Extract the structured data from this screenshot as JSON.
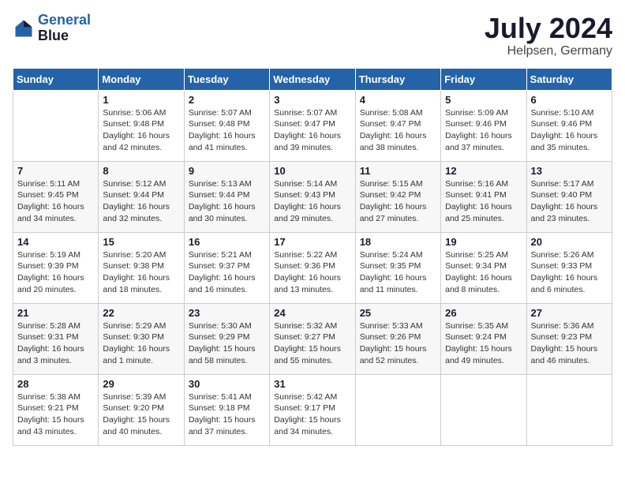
{
  "logo": {
    "line1": "General",
    "line2": "Blue"
  },
  "title": "July 2024",
  "subtitle": "Helpsen, Germany",
  "days_of_week": [
    "Sunday",
    "Monday",
    "Tuesday",
    "Wednesday",
    "Thursday",
    "Friday",
    "Saturday"
  ],
  "weeks": [
    [
      {
        "day": "",
        "info": ""
      },
      {
        "day": "1",
        "info": "Sunrise: 5:06 AM\nSunset: 9:48 PM\nDaylight: 16 hours\nand 42 minutes."
      },
      {
        "day": "2",
        "info": "Sunrise: 5:07 AM\nSunset: 9:48 PM\nDaylight: 16 hours\nand 41 minutes."
      },
      {
        "day": "3",
        "info": "Sunrise: 5:07 AM\nSunset: 9:47 PM\nDaylight: 16 hours\nand 39 minutes."
      },
      {
        "day": "4",
        "info": "Sunrise: 5:08 AM\nSunset: 9:47 PM\nDaylight: 16 hours\nand 38 minutes."
      },
      {
        "day": "5",
        "info": "Sunrise: 5:09 AM\nSunset: 9:46 PM\nDaylight: 16 hours\nand 37 minutes."
      },
      {
        "day": "6",
        "info": "Sunrise: 5:10 AM\nSunset: 9:46 PM\nDaylight: 16 hours\nand 35 minutes."
      }
    ],
    [
      {
        "day": "7",
        "info": "Sunrise: 5:11 AM\nSunset: 9:45 PM\nDaylight: 16 hours\nand 34 minutes."
      },
      {
        "day": "8",
        "info": "Sunrise: 5:12 AM\nSunset: 9:44 PM\nDaylight: 16 hours\nand 32 minutes."
      },
      {
        "day": "9",
        "info": "Sunrise: 5:13 AM\nSunset: 9:44 PM\nDaylight: 16 hours\nand 30 minutes."
      },
      {
        "day": "10",
        "info": "Sunrise: 5:14 AM\nSunset: 9:43 PM\nDaylight: 16 hours\nand 29 minutes."
      },
      {
        "day": "11",
        "info": "Sunrise: 5:15 AM\nSunset: 9:42 PM\nDaylight: 16 hours\nand 27 minutes."
      },
      {
        "day": "12",
        "info": "Sunrise: 5:16 AM\nSunset: 9:41 PM\nDaylight: 16 hours\nand 25 minutes."
      },
      {
        "day": "13",
        "info": "Sunrise: 5:17 AM\nSunset: 9:40 PM\nDaylight: 16 hours\nand 23 minutes."
      }
    ],
    [
      {
        "day": "14",
        "info": "Sunrise: 5:19 AM\nSunset: 9:39 PM\nDaylight: 16 hours\nand 20 minutes."
      },
      {
        "day": "15",
        "info": "Sunrise: 5:20 AM\nSunset: 9:38 PM\nDaylight: 16 hours\nand 18 minutes."
      },
      {
        "day": "16",
        "info": "Sunrise: 5:21 AM\nSunset: 9:37 PM\nDaylight: 16 hours\nand 16 minutes."
      },
      {
        "day": "17",
        "info": "Sunrise: 5:22 AM\nSunset: 9:36 PM\nDaylight: 16 hours\nand 13 minutes."
      },
      {
        "day": "18",
        "info": "Sunrise: 5:24 AM\nSunset: 9:35 PM\nDaylight: 16 hours\nand 11 minutes."
      },
      {
        "day": "19",
        "info": "Sunrise: 5:25 AM\nSunset: 9:34 PM\nDaylight: 16 hours\nand 8 minutes."
      },
      {
        "day": "20",
        "info": "Sunrise: 5:26 AM\nSunset: 9:33 PM\nDaylight: 16 hours\nand 6 minutes."
      }
    ],
    [
      {
        "day": "21",
        "info": "Sunrise: 5:28 AM\nSunset: 9:31 PM\nDaylight: 16 hours\nand 3 minutes."
      },
      {
        "day": "22",
        "info": "Sunrise: 5:29 AM\nSunset: 9:30 PM\nDaylight: 16 hours\nand 1 minute."
      },
      {
        "day": "23",
        "info": "Sunrise: 5:30 AM\nSunset: 9:29 PM\nDaylight: 15 hours\nand 58 minutes."
      },
      {
        "day": "24",
        "info": "Sunrise: 5:32 AM\nSunset: 9:27 PM\nDaylight: 15 hours\nand 55 minutes."
      },
      {
        "day": "25",
        "info": "Sunrise: 5:33 AM\nSunset: 9:26 PM\nDaylight: 15 hours\nand 52 minutes."
      },
      {
        "day": "26",
        "info": "Sunrise: 5:35 AM\nSunset: 9:24 PM\nDaylight: 15 hours\nand 49 minutes."
      },
      {
        "day": "27",
        "info": "Sunrise: 5:36 AM\nSunset: 9:23 PM\nDaylight: 15 hours\nand 46 minutes."
      }
    ],
    [
      {
        "day": "28",
        "info": "Sunrise: 5:38 AM\nSunset: 9:21 PM\nDaylight: 15 hours\nand 43 minutes."
      },
      {
        "day": "29",
        "info": "Sunrise: 5:39 AM\nSunset: 9:20 PM\nDaylight: 15 hours\nand 40 minutes."
      },
      {
        "day": "30",
        "info": "Sunrise: 5:41 AM\nSunset: 9:18 PM\nDaylight: 15 hours\nand 37 minutes."
      },
      {
        "day": "31",
        "info": "Sunrise: 5:42 AM\nSunset: 9:17 PM\nDaylight: 15 hours\nand 34 minutes."
      },
      {
        "day": "",
        "info": ""
      },
      {
        "day": "",
        "info": ""
      },
      {
        "day": "",
        "info": ""
      }
    ]
  ]
}
